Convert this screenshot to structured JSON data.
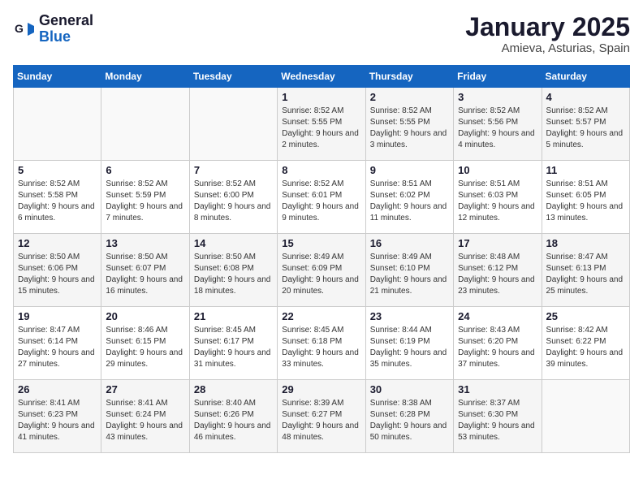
{
  "header": {
    "logo_general": "General",
    "logo_blue": "Blue",
    "month": "January 2025",
    "location": "Amieva, Asturias, Spain"
  },
  "weekdays": [
    "Sunday",
    "Monday",
    "Tuesday",
    "Wednesday",
    "Thursday",
    "Friday",
    "Saturday"
  ],
  "weeks": [
    [
      {
        "day": "",
        "detail": ""
      },
      {
        "day": "",
        "detail": ""
      },
      {
        "day": "",
        "detail": ""
      },
      {
        "day": "1",
        "detail": "Sunrise: 8:52 AM\nSunset: 5:55 PM\nDaylight: 9 hours and 2 minutes."
      },
      {
        "day": "2",
        "detail": "Sunrise: 8:52 AM\nSunset: 5:55 PM\nDaylight: 9 hours and 3 minutes."
      },
      {
        "day": "3",
        "detail": "Sunrise: 8:52 AM\nSunset: 5:56 PM\nDaylight: 9 hours and 4 minutes."
      },
      {
        "day": "4",
        "detail": "Sunrise: 8:52 AM\nSunset: 5:57 PM\nDaylight: 9 hours and 5 minutes."
      }
    ],
    [
      {
        "day": "5",
        "detail": "Sunrise: 8:52 AM\nSunset: 5:58 PM\nDaylight: 9 hours and 6 minutes."
      },
      {
        "day": "6",
        "detail": "Sunrise: 8:52 AM\nSunset: 5:59 PM\nDaylight: 9 hours and 7 minutes."
      },
      {
        "day": "7",
        "detail": "Sunrise: 8:52 AM\nSunset: 6:00 PM\nDaylight: 9 hours and 8 minutes."
      },
      {
        "day": "8",
        "detail": "Sunrise: 8:52 AM\nSunset: 6:01 PM\nDaylight: 9 hours and 9 minutes."
      },
      {
        "day": "9",
        "detail": "Sunrise: 8:51 AM\nSunset: 6:02 PM\nDaylight: 9 hours and 11 minutes."
      },
      {
        "day": "10",
        "detail": "Sunrise: 8:51 AM\nSunset: 6:03 PM\nDaylight: 9 hours and 12 minutes."
      },
      {
        "day": "11",
        "detail": "Sunrise: 8:51 AM\nSunset: 6:05 PM\nDaylight: 9 hours and 13 minutes."
      }
    ],
    [
      {
        "day": "12",
        "detail": "Sunrise: 8:50 AM\nSunset: 6:06 PM\nDaylight: 9 hours and 15 minutes."
      },
      {
        "day": "13",
        "detail": "Sunrise: 8:50 AM\nSunset: 6:07 PM\nDaylight: 9 hours and 16 minutes."
      },
      {
        "day": "14",
        "detail": "Sunrise: 8:50 AM\nSunset: 6:08 PM\nDaylight: 9 hours and 18 minutes."
      },
      {
        "day": "15",
        "detail": "Sunrise: 8:49 AM\nSunset: 6:09 PM\nDaylight: 9 hours and 20 minutes."
      },
      {
        "day": "16",
        "detail": "Sunrise: 8:49 AM\nSunset: 6:10 PM\nDaylight: 9 hours and 21 minutes."
      },
      {
        "day": "17",
        "detail": "Sunrise: 8:48 AM\nSunset: 6:12 PM\nDaylight: 9 hours and 23 minutes."
      },
      {
        "day": "18",
        "detail": "Sunrise: 8:47 AM\nSunset: 6:13 PM\nDaylight: 9 hours and 25 minutes."
      }
    ],
    [
      {
        "day": "19",
        "detail": "Sunrise: 8:47 AM\nSunset: 6:14 PM\nDaylight: 9 hours and 27 minutes."
      },
      {
        "day": "20",
        "detail": "Sunrise: 8:46 AM\nSunset: 6:15 PM\nDaylight: 9 hours and 29 minutes."
      },
      {
        "day": "21",
        "detail": "Sunrise: 8:45 AM\nSunset: 6:17 PM\nDaylight: 9 hours and 31 minutes."
      },
      {
        "day": "22",
        "detail": "Sunrise: 8:45 AM\nSunset: 6:18 PM\nDaylight: 9 hours and 33 minutes."
      },
      {
        "day": "23",
        "detail": "Sunrise: 8:44 AM\nSunset: 6:19 PM\nDaylight: 9 hours and 35 minutes."
      },
      {
        "day": "24",
        "detail": "Sunrise: 8:43 AM\nSunset: 6:20 PM\nDaylight: 9 hours and 37 minutes."
      },
      {
        "day": "25",
        "detail": "Sunrise: 8:42 AM\nSunset: 6:22 PM\nDaylight: 9 hours and 39 minutes."
      }
    ],
    [
      {
        "day": "26",
        "detail": "Sunrise: 8:41 AM\nSunset: 6:23 PM\nDaylight: 9 hours and 41 minutes."
      },
      {
        "day": "27",
        "detail": "Sunrise: 8:41 AM\nSunset: 6:24 PM\nDaylight: 9 hours and 43 minutes."
      },
      {
        "day": "28",
        "detail": "Sunrise: 8:40 AM\nSunset: 6:26 PM\nDaylight: 9 hours and 46 minutes."
      },
      {
        "day": "29",
        "detail": "Sunrise: 8:39 AM\nSunset: 6:27 PM\nDaylight: 9 hours and 48 minutes."
      },
      {
        "day": "30",
        "detail": "Sunrise: 8:38 AM\nSunset: 6:28 PM\nDaylight: 9 hours and 50 minutes."
      },
      {
        "day": "31",
        "detail": "Sunrise: 8:37 AM\nSunset: 6:30 PM\nDaylight: 9 hours and 53 minutes."
      },
      {
        "day": "",
        "detail": ""
      }
    ]
  ]
}
